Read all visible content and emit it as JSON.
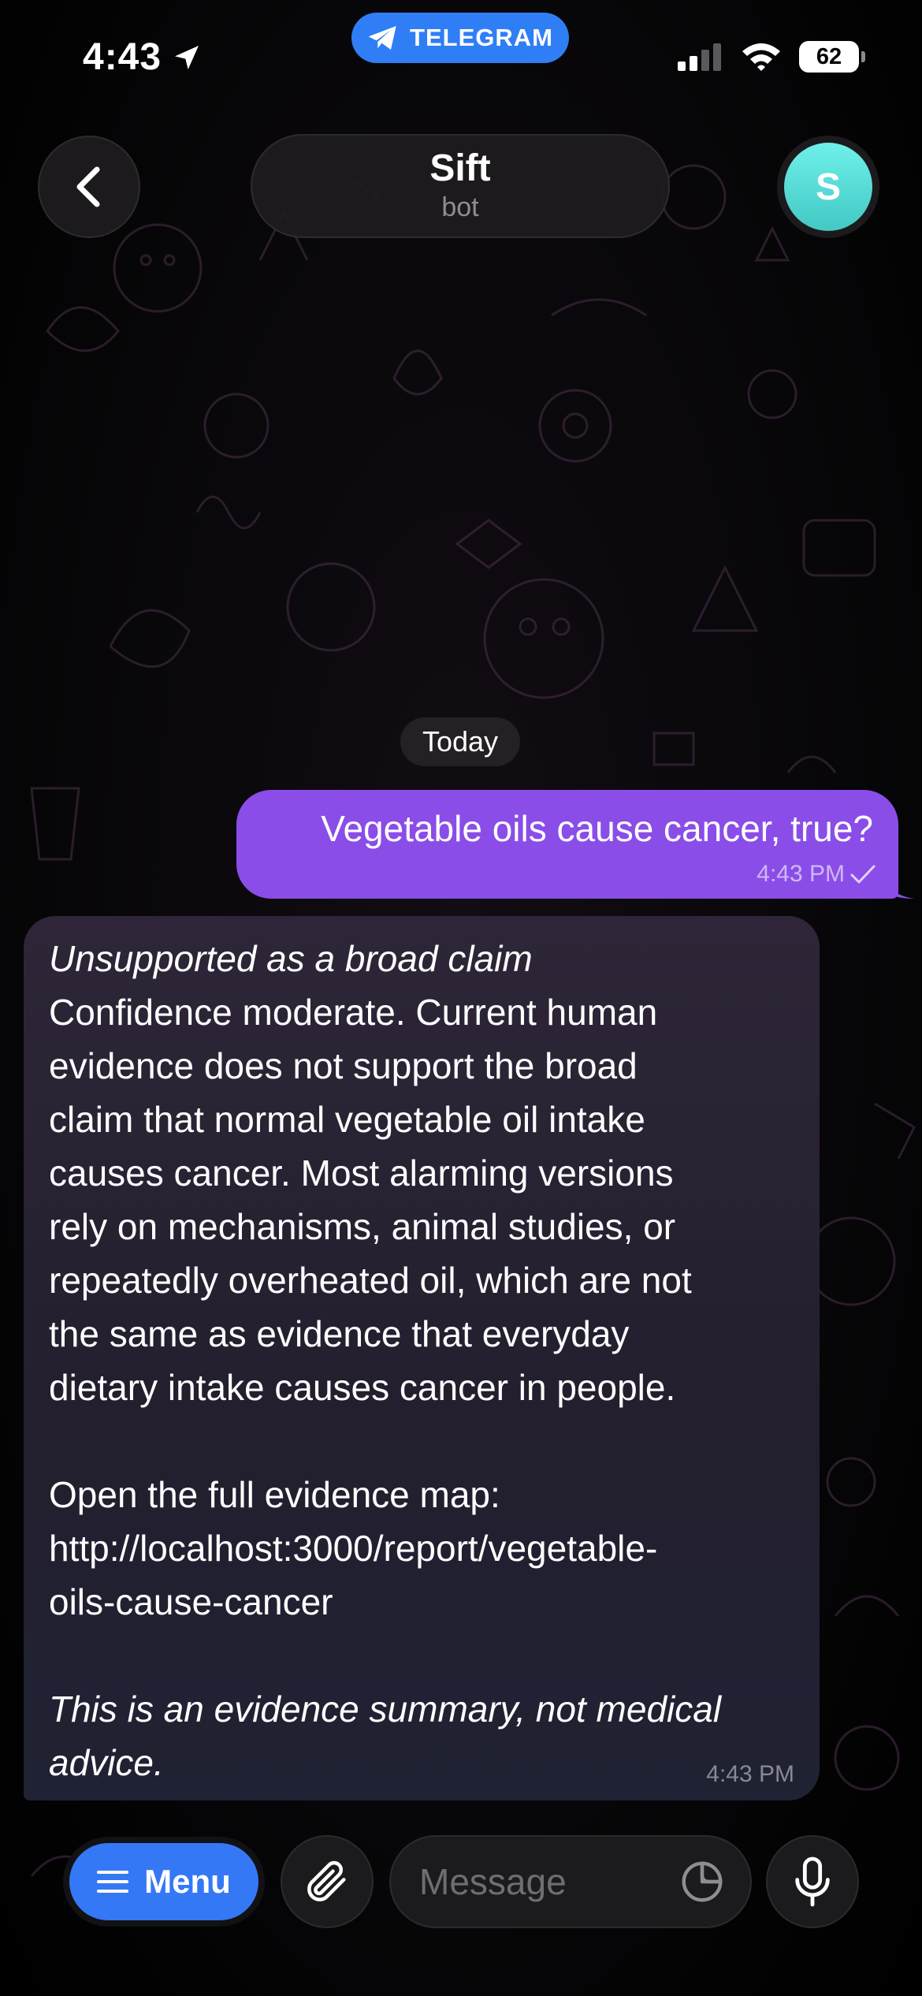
{
  "status_bar": {
    "time": "4:43",
    "center_badge": "TELEGRAM",
    "battery": "62",
    "icons": [
      "location-arrow-icon",
      "telegram-plane-icon",
      "cellular-signal-icon",
      "wifi-icon",
      "battery-icon"
    ]
  },
  "header": {
    "back_icon": "chevron-left-icon",
    "title": "Sift",
    "subtitle": "bot",
    "avatar_letter": "S",
    "avatar_color": "#5fe0dc"
  },
  "chat": {
    "date_label": "Today",
    "messages": [
      {
        "direction": "outgoing",
        "text": "Vegetable oils cause cancer, true?",
        "time": "4:43 PM",
        "status_icon": "single-check-icon",
        "bubble_color": "#8a4de8"
      },
      {
        "direction": "incoming",
        "lines": [
          "Unsupported as a broad claim",
          "Confidence moderate. Current human",
          "evidence does not support the broad",
          "claim that normal vegetable oil intake",
          "causes cancer. Most alarming versions",
          "rely on mechanisms, animal studies, or",
          "repeatedly overheated oil, which are not",
          "the same as evidence that everyday",
          "dietary intake causes cancer in people.",
          "",
          "Open the full evidence map:",
          "http://localhost:3000/report/vegetable-",
          "oils-cause-cancer",
          "",
          "This is an evidence summary, not medical",
          "advice."
        ],
        "time": "4:43 PM"
      }
    ]
  },
  "composer": {
    "menu_label": "Menu",
    "menu_icon": "hamburger-icon",
    "attach_icon": "paperclip-icon",
    "placeholder": "Message",
    "sticker_icon": "sticker-icon",
    "mic_icon": "microphone-icon",
    "accent_color": "#3478f6"
  }
}
